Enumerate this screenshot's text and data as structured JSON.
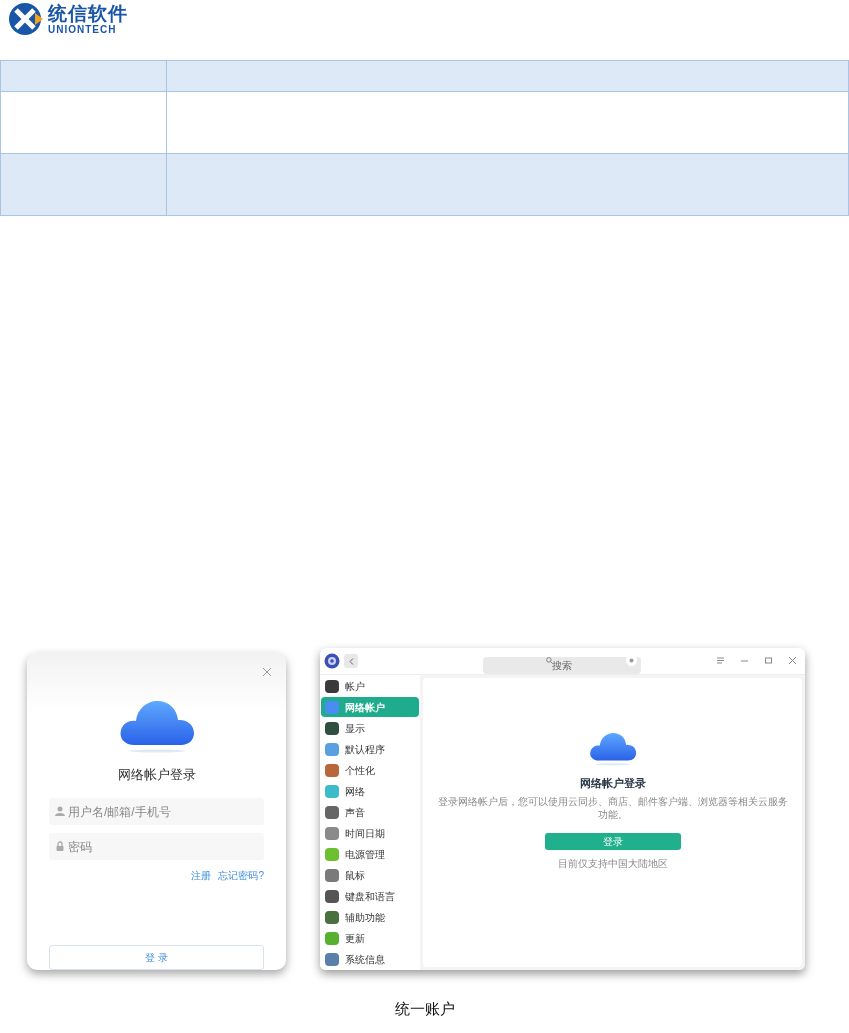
{
  "logo": {
    "name": "统信软件",
    "subtitle": "UNIONTECH"
  },
  "login_dialog": {
    "title": "网络帐户登录",
    "username_placeholder": "用户名/邮箱/手机号",
    "password_placeholder": "密码",
    "links": [
      "注册",
      "忘记密码?"
    ],
    "button": "登 录"
  },
  "settings_window": {
    "search_placeholder": "搜索",
    "sidebar": [
      {
        "label": "帐户",
        "selected": false,
        "color": "#3a3a3a"
      },
      {
        "label": "网络帐户",
        "selected": true,
        "color": "#4a8df0"
      },
      {
        "label": "显示",
        "selected": false,
        "color": "#2f4f3f"
      },
      {
        "label": "默认程序",
        "selected": false,
        "color": "#5aa0e0"
      },
      {
        "label": "个性化",
        "selected": false,
        "color": "#b8663a"
      },
      {
        "label": "网络",
        "selected": false,
        "color": "#3cbcc8"
      },
      {
        "label": "声音",
        "selected": false,
        "color": "#666666"
      },
      {
        "label": "时间日期",
        "selected": false,
        "color": "#8a8a8a"
      },
      {
        "label": "电源管理",
        "selected": false,
        "color": "#6cc030"
      },
      {
        "label": "鼠标",
        "selected": false,
        "color": "#7a7a7a"
      },
      {
        "label": "键盘和语言",
        "selected": false,
        "color": "#555555"
      },
      {
        "label": "辅助功能",
        "selected": false,
        "color": "#4a7040"
      },
      {
        "label": "更新",
        "selected": false,
        "color": "#58b030"
      },
      {
        "label": "系统信息",
        "selected": false,
        "color": "#5a7fa8"
      }
    ],
    "title": "网络帐户登录",
    "description": "登录网络帐户后，您可以使用云同步、商店、邮件客户端、浏览器等相关云服务功能。",
    "button": "登录",
    "note": "目前仅支持中国大陆地区"
  },
  "caption": "统一账户"
}
